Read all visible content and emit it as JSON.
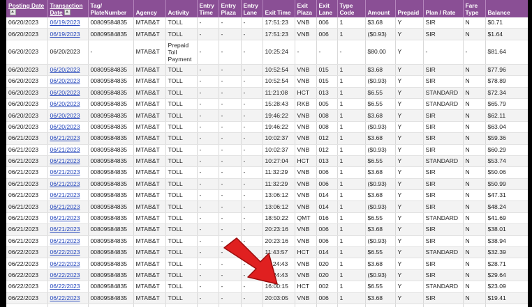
{
  "headers": {
    "posting_date": "Posting Date",
    "transaction_date": "Transaction Date",
    "tag": "Tag/ PlateNumber",
    "agency": "Agency",
    "activity": "Activity",
    "entry_time": "Entry Time",
    "entry_plaza": "Entry Plaza",
    "entry_lane": "Entry Lane",
    "exit_time": "Exit Time",
    "exit_plaza": "Exit Plaza",
    "exit_lane": "Exit Lane",
    "type_code": "Type Code",
    "amount": "Amount",
    "prepaid": "Prepaid",
    "plan_rate": "Plan / Rate",
    "fare_type": "Fare Type",
    "balance": "Balance"
  },
  "rows": [
    {
      "posting": "06/20/2023",
      "trans": "06/19/2023",
      "link": true,
      "tag": "00809584835",
      "agency": "MTAB&T",
      "activity": "TOLL",
      "entry_time": "-",
      "entry_plaza": "-",
      "entry_lane": "-",
      "exit_time": "17:51:23",
      "exit_plaza": "VNB",
      "exit_lane": "006",
      "type": "1",
      "amount": "$3.68",
      "prepaid": "Y",
      "plan": "SIR",
      "fare": "N",
      "balance": "$0.71"
    },
    {
      "posting": "06/20/2023",
      "trans": "06/19/2023",
      "link": true,
      "tag": "00809584835",
      "agency": "MTAB&T",
      "activity": "TOLL",
      "entry_time": "-",
      "entry_plaza": "-",
      "entry_lane": "-",
      "exit_time": "17:51:23",
      "exit_plaza": "VNB",
      "exit_lane": "006",
      "type": "1",
      "amount": "($0.93)",
      "prepaid": "Y",
      "plan": "SIR",
      "fare": "N",
      "balance": "$1.64"
    },
    {
      "posting": "06/20/2023",
      "trans": "06/20/2023",
      "link": false,
      "tall": true,
      "tag": "-",
      "agency": "MTAB&T",
      "activity": "Prepaid Toll Payment",
      "entry_time": "-",
      "entry_plaza": "-",
      "entry_lane": "-",
      "exit_time": "10:25:24",
      "exit_plaza": "-",
      "exit_lane": "-",
      "type": "-",
      "amount": "$80.00",
      "prepaid": "Y",
      "plan": "-",
      "fare": "-",
      "balance": "$81.64"
    },
    {
      "posting": "06/20/2023",
      "trans": "06/20/2023",
      "link": true,
      "tag": "00809584835",
      "agency": "MTAB&T",
      "activity": "TOLL",
      "entry_time": "-",
      "entry_plaza": "-",
      "entry_lane": "-",
      "exit_time": "10:52:54",
      "exit_plaza": "VNB",
      "exit_lane": "015",
      "type": "1",
      "amount": "$3.68",
      "prepaid": "Y",
      "plan": "SIR",
      "fare": "N",
      "balance": "$77.96"
    },
    {
      "posting": "06/20/2023",
      "trans": "06/20/2023",
      "link": true,
      "tag": "00809584835",
      "agency": "MTAB&T",
      "activity": "TOLL",
      "entry_time": "-",
      "entry_plaza": "-",
      "entry_lane": "-",
      "exit_time": "10:52:54",
      "exit_plaza": "VNB",
      "exit_lane": "015",
      "type": "1",
      "amount": "($0.93)",
      "prepaid": "Y",
      "plan": "SIR",
      "fare": "N",
      "balance": "$78.89"
    },
    {
      "posting": "06/20/2023",
      "trans": "06/20/2023",
      "link": true,
      "tag": "00809584835",
      "agency": "MTAB&T",
      "activity": "TOLL",
      "entry_time": "-",
      "entry_plaza": "-",
      "entry_lane": "-",
      "exit_time": "11:21:08",
      "exit_plaza": "HCT",
      "exit_lane": "013",
      "type": "1",
      "amount": "$6.55",
      "prepaid": "Y",
      "plan": "STANDARD",
      "fare": "N",
      "balance": "$72.34"
    },
    {
      "posting": "06/20/2023",
      "trans": "06/20/2023",
      "link": true,
      "tag": "00809584835",
      "agency": "MTAB&T",
      "activity": "TOLL",
      "entry_time": "-",
      "entry_plaza": "-",
      "entry_lane": "-",
      "exit_time": "15:28:43",
      "exit_plaza": "RKB",
      "exit_lane": "005",
      "type": "1",
      "amount": "$6.55",
      "prepaid": "Y",
      "plan": "STANDARD",
      "fare": "N",
      "balance": "$65.79"
    },
    {
      "posting": "06/20/2023",
      "trans": "06/20/2023",
      "link": true,
      "tag": "00809584835",
      "agency": "MTAB&T",
      "activity": "TOLL",
      "entry_time": "-",
      "entry_plaza": "-",
      "entry_lane": "-",
      "exit_time": "19:46:22",
      "exit_plaza": "VNB",
      "exit_lane": "008",
      "type": "1",
      "amount": "$3.68",
      "prepaid": "Y",
      "plan": "SIR",
      "fare": "N",
      "balance": "$62.11"
    },
    {
      "posting": "06/20/2023",
      "trans": "06/20/2023",
      "link": true,
      "tag": "00809584835",
      "agency": "MTAB&T",
      "activity": "TOLL",
      "entry_time": "-",
      "entry_plaza": "-",
      "entry_lane": "-",
      "exit_time": "19:46:22",
      "exit_plaza": "VNB",
      "exit_lane": "008",
      "type": "1",
      "amount": "($0.93)",
      "prepaid": "Y",
      "plan": "SIR",
      "fare": "N",
      "balance": "$63.04"
    },
    {
      "posting": "06/21/2023",
      "trans": "06/21/2023",
      "link": true,
      "tag": "00809584835",
      "agency": "MTAB&T",
      "activity": "TOLL",
      "entry_time": "-",
      "entry_plaza": "-",
      "entry_lane": "-",
      "exit_time": "10:02:37",
      "exit_plaza": "VNB",
      "exit_lane": "012",
      "type": "1",
      "amount": "$3.68",
      "prepaid": "Y",
      "plan": "SIR",
      "fare": "N",
      "balance": "$59.36"
    },
    {
      "posting": "06/21/2023",
      "trans": "06/21/2023",
      "link": true,
      "tag": "00809584835",
      "agency": "MTAB&T",
      "activity": "TOLL",
      "entry_time": "-",
      "entry_plaza": "-",
      "entry_lane": "-",
      "exit_time": "10:02:37",
      "exit_plaza": "VNB",
      "exit_lane": "012",
      "type": "1",
      "amount": "($0.93)",
      "prepaid": "Y",
      "plan": "SIR",
      "fare": "N",
      "balance": "$60.29"
    },
    {
      "posting": "06/21/2023",
      "trans": "06/21/2023",
      "link": true,
      "tag": "00809584835",
      "agency": "MTAB&T",
      "activity": "TOLL",
      "entry_time": "-",
      "entry_plaza": "-",
      "entry_lane": "-",
      "exit_time": "10:27:04",
      "exit_plaza": "HCT",
      "exit_lane": "013",
      "type": "1",
      "amount": "$6.55",
      "prepaid": "Y",
      "plan": "STANDARD",
      "fare": "N",
      "balance": "$53.74"
    },
    {
      "posting": "06/21/2023",
      "trans": "06/21/2023",
      "link": true,
      "tag": "00809584835",
      "agency": "MTAB&T",
      "activity": "TOLL",
      "entry_time": "-",
      "entry_plaza": "-",
      "entry_lane": "-",
      "exit_time": "11:32:29",
      "exit_plaza": "VNB",
      "exit_lane": "006",
      "type": "1",
      "amount": "$3.68",
      "prepaid": "Y",
      "plan": "SIR",
      "fare": "N",
      "balance": "$50.06"
    },
    {
      "posting": "06/21/2023",
      "trans": "06/21/2023",
      "link": true,
      "tag": "00809584835",
      "agency": "MTAB&T",
      "activity": "TOLL",
      "entry_time": "-",
      "entry_plaza": "-",
      "entry_lane": "-",
      "exit_time": "11:32:29",
      "exit_plaza": "VNB",
      "exit_lane": "006",
      "type": "1",
      "amount": "($0.93)",
      "prepaid": "Y",
      "plan": "SIR",
      "fare": "N",
      "balance": "$50.99"
    },
    {
      "posting": "06/21/2023",
      "trans": "06/21/2023",
      "link": true,
      "tag": "00809584835",
      "agency": "MTAB&T",
      "activity": "TOLL",
      "entry_time": "-",
      "entry_plaza": "-",
      "entry_lane": "-",
      "exit_time": "13:06:12",
      "exit_plaza": "VNB",
      "exit_lane": "014",
      "type": "1",
      "amount": "$3.68",
      "prepaid": "Y",
      "plan": "SIR",
      "fare": "N",
      "balance": "$47.31"
    },
    {
      "posting": "06/21/2023",
      "trans": "06/21/2023",
      "link": true,
      "tag": "00809584835",
      "agency": "MTAB&T",
      "activity": "TOLL",
      "entry_time": "-",
      "entry_plaza": "-",
      "entry_lane": "-",
      "exit_time": "13:06:12",
      "exit_plaza": "VNB",
      "exit_lane": "014",
      "type": "1",
      "amount": "($0.93)",
      "prepaid": "Y",
      "plan": "SIR",
      "fare": "N",
      "balance": "$48.24"
    },
    {
      "posting": "06/21/2023",
      "trans": "06/21/2023",
      "link": true,
      "tag": "00809584835",
      "agency": "MTAB&T",
      "activity": "TOLL",
      "entry_time": "-",
      "entry_plaza": "-",
      "entry_lane": "-",
      "exit_time": "18:50:22",
      "exit_plaza": "QMT",
      "exit_lane": "016",
      "type": "1",
      "amount": "$6.55",
      "prepaid": "Y",
      "plan": "STANDARD",
      "fare": "N",
      "balance": "$41.69"
    },
    {
      "posting": "06/21/2023",
      "trans": "06/21/2023",
      "link": true,
      "tag": "00809584835",
      "agency": "MTAB&T",
      "activity": "TOLL",
      "entry_time": "-",
      "entry_plaza": "-",
      "entry_lane": "-",
      "exit_time": "20:23:16",
      "exit_plaza": "VNB",
      "exit_lane": "006",
      "type": "1",
      "amount": "$3.68",
      "prepaid": "Y",
      "plan": "SIR",
      "fare": "N",
      "balance": "$38.01"
    },
    {
      "posting": "06/21/2023",
      "trans": "06/21/2023",
      "link": true,
      "tag": "00809584835",
      "agency": "MTAB&T",
      "activity": "TOLL",
      "entry_time": "-",
      "entry_plaza": "-",
      "entry_lane": "-",
      "exit_time": "20:23:16",
      "exit_plaza": "VNB",
      "exit_lane": "006",
      "type": "1",
      "amount": "($0.93)",
      "prepaid": "Y",
      "plan": "SIR",
      "fare": "N",
      "balance": "$38.94"
    },
    {
      "posting": "06/22/2023",
      "trans": "06/22/2023",
      "link": true,
      "tag": "00809584835",
      "agency": "MTAB&T",
      "activity": "TOLL",
      "entry_time": "-",
      "entry_plaza": "-",
      "entry_lane": "-",
      "exit_time": "11:43:57",
      "exit_plaza": "HCT",
      "exit_lane": "014",
      "type": "1",
      "amount": "$6.55",
      "prepaid": "Y",
      "plan": "STANDARD",
      "fare": "N",
      "balance": "$32.39"
    },
    {
      "posting": "06/22/2023",
      "trans": "06/22/2023",
      "link": true,
      "tag": "00809584835",
      "agency": "MTAB&T",
      "activity": "TOLL",
      "entry_time": "-",
      "entry_plaza": "-",
      "entry_lane": "-",
      "exit_time": "11:24:43",
      "exit_plaza": "VNB",
      "exit_lane": "020",
      "type": "1",
      "amount": "$3.68",
      "prepaid": "Y",
      "plan": "SIR",
      "fare": "N",
      "balance": "$28.71"
    },
    {
      "posting": "06/22/2023",
      "trans": "06/22/2023",
      "link": true,
      "tag": "00809584835",
      "agency": "MTAB&T",
      "activity": "TOLL",
      "entry_time": "-",
      "entry_plaza": "-",
      "entry_lane": "-",
      "exit_time": "11:24:43",
      "exit_plaza": "VNB",
      "exit_lane": "020",
      "type": "1",
      "amount": "($0.93)",
      "prepaid": "Y",
      "plan": "SIR",
      "fare": "N",
      "balance": "$29.64"
    },
    {
      "posting": "06/22/2023",
      "trans": "06/22/2023",
      "link": true,
      "tag": "00809584835",
      "agency": "MTAB&T",
      "activity": "TOLL",
      "entry_time": "-",
      "entry_plaza": "-",
      "entry_lane": "-",
      "exit_time": "16:00:15",
      "exit_plaza": "HCT",
      "exit_lane": "002",
      "type": "1",
      "amount": "$6.55",
      "prepaid": "Y",
      "plan": "STANDARD",
      "fare": "N",
      "balance": "$23.09"
    },
    {
      "posting": "06/22/2023",
      "trans": "06/22/2023",
      "link": true,
      "tag": "00809584835",
      "agency": "MTAB&T",
      "activity": "TOLL",
      "entry_time": "-",
      "entry_plaza": "-",
      "entry_lane": "-",
      "exit_time": "20:03:05",
      "exit_plaza": "VNB",
      "exit_lane": "006",
      "type": "1",
      "amount": "$3.68",
      "prepaid": "Y",
      "plan": "SIR",
      "fare": "N",
      "balance": "$19.41"
    },
    {
      "posting": "06/22/2023",
      "trans": "06/22/2023",
      "link": true,
      "tag": "00809584835",
      "agency": "MTAB&T",
      "activity": "TOLL",
      "entry_time": "-",
      "entry_plaza": "-",
      "entry_lane": "-",
      "exit_time": "20:03:05",
      "exit_plaza": "VNB",
      "exit_lane": "006",
      "type": "1",
      "amount": "($0.93)",
      "prepaid": "Y",
      "plan": "SIR",
      "fare": "N",
      "balance": "$20.34"
    }
  ],
  "colors": {
    "header_bg": "#8a4f95",
    "link": "#2244bb",
    "arrow": "#e02020"
  },
  "icons": {
    "sort": "sort-icon",
    "annotation": "red-arrow-icon"
  }
}
